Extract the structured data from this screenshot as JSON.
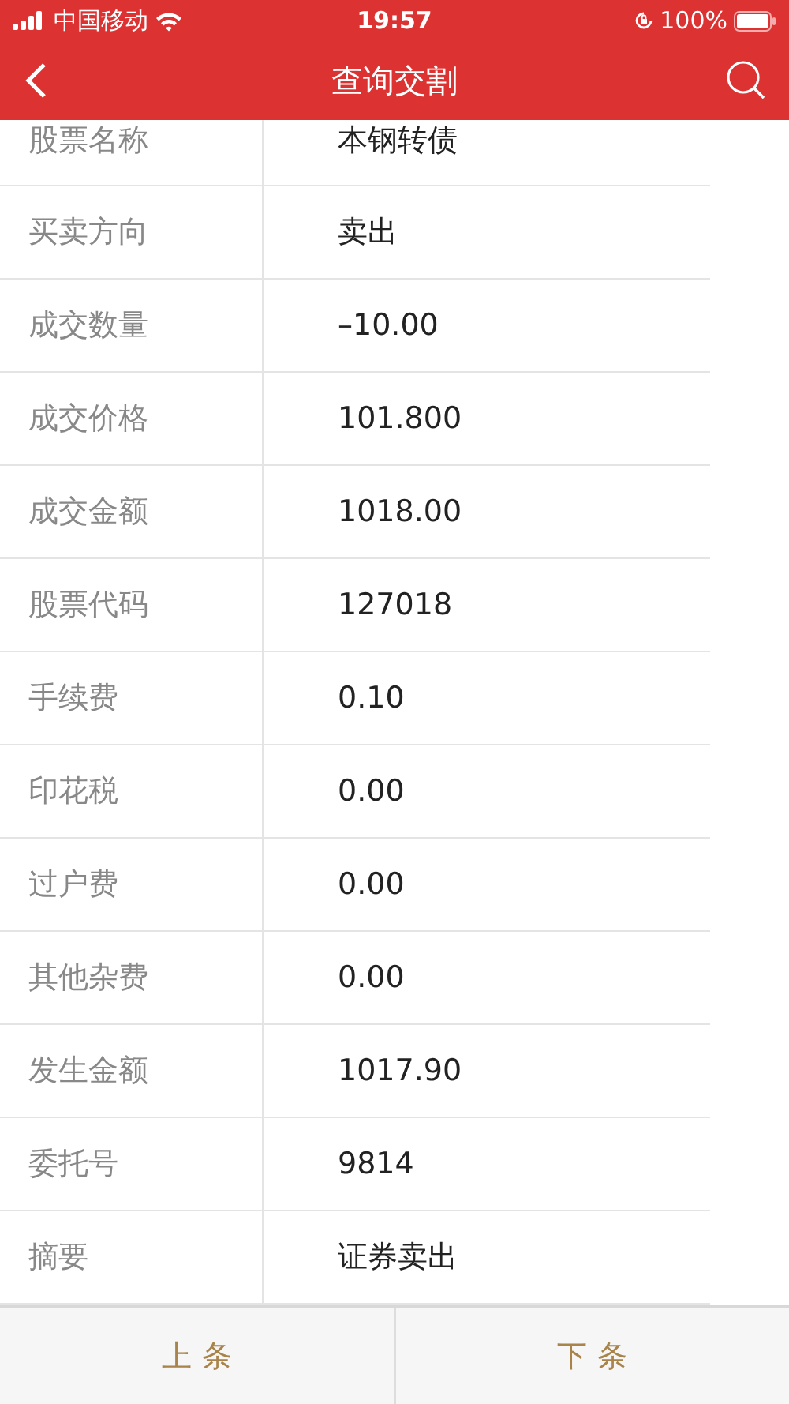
{
  "status_bar": {
    "carrier": "中国移动",
    "time": "19:57",
    "battery": "100%"
  },
  "nav": {
    "title": "查询交割"
  },
  "rows": [
    {
      "label": "股票名称",
      "value": "本钢转债"
    },
    {
      "label": "买卖方向",
      "value": "卖出"
    },
    {
      "label": "成交数量",
      "value": "–10.00"
    },
    {
      "label": "成交价格",
      "value": "101.800"
    },
    {
      "label": "成交金额",
      "value": "1018.00"
    },
    {
      "label": "股票代码",
      "value": "127018"
    },
    {
      "label": "手续费",
      "value": "0.10"
    },
    {
      "label": "印花税",
      "value": "0.00"
    },
    {
      "label": "过户费",
      "value": "0.00"
    },
    {
      "label": "其他杂费",
      "value": "0.00"
    },
    {
      "label": "发生金额",
      "value": "1017.90"
    },
    {
      "label": "委托号",
      "value": "9814"
    },
    {
      "label": "摘要",
      "value": "证券卖出"
    }
  ],
  "buttons": [
    "上 条",
    "下 条"
  ]
}
